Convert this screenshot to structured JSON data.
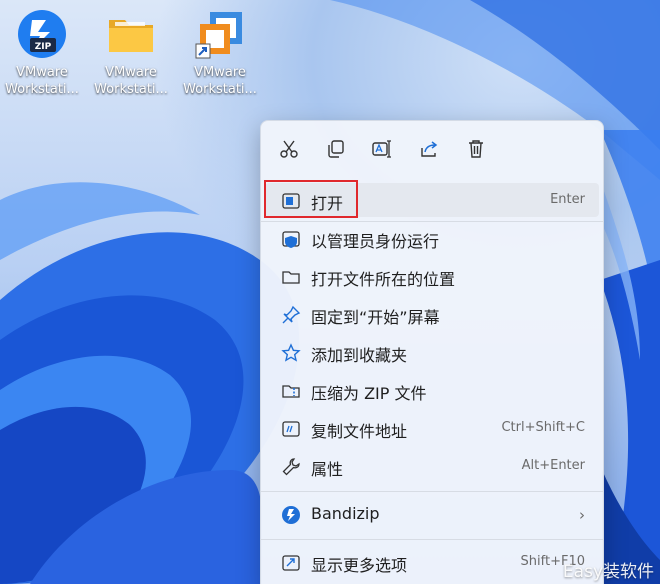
{
  "desktop": {
    "icons": [
      {
        "icon": "bandizip-zip-icon",
        "label_lines": [
          "VMware",
          "Workstati..."
        ]
      },
      {
        "icon": "folder-icon",
        "label_lines": [
          "VMware",
          "Workstati..."
        ]
      },
      {
        "icon": "vmware-shortcut-icon",
        "label_lines": [
          "VMware",
          "Workstati..."
        ]
      }
    ]
  },
  "context_menu": {
    "toolbar": [
      {
        "icon": "cut-icon"
      },
      {
        "icon": "copy-icon"
      },
      {
        "icon": "rename-icon"
      },
      {
        "icon": "share-icon"
      },
      {
        "icon": "delete-icon"
      }
    ],
    "items": [
      {
        "icon": "open-icon",
        "label": "打开",
        "shortcut": "Enter",
        "highlighted": true
      },
      {
        "icon": "shield-icon",
        "label": "以管理员身份运行",
        "shortcut": ""
      },
      {
        "icon": "folder-icon",
        "label": "打开文件所在的位置",
        "shortcut": ""
      },
      {
        "icon": "pin-icon",
        "label": "固定到“开始”屏幕",
        "shortcut": ""
      },
      {
        "icon": "star-icon",
        "label": "添加到收藏夹",
        "shortcut": ""
      },
      {
        "icon": "zip-folder-icon",
        "label": "压缩为 ZIP 文件",
        "shortcut": ""
      },
      {
        "icon": "copy-path-icon",
        "label": "复制文件地址",
        "shortcut": "Ctrl+Shift+C"
      },
      {
        "icon": "wrench-icon",
        "label": "属性",
        "shortcut": "Alt+Enter"
      },
      {
        "icon": "bandizip-icon",
        "label": "Bandizip",
        "shortcut": "",
        "submenu": "›"
      },
      {
        "icon": "more-options-icon",
        "label": "显示更多选项",
        "shortcut": "Shift+F10"
      }
    ]
  },
  "watermark": "Easy装软件",
  "colors": {
    "accent": "#0067c0",
    "highlight_box": "#e0282d"
  }
}
